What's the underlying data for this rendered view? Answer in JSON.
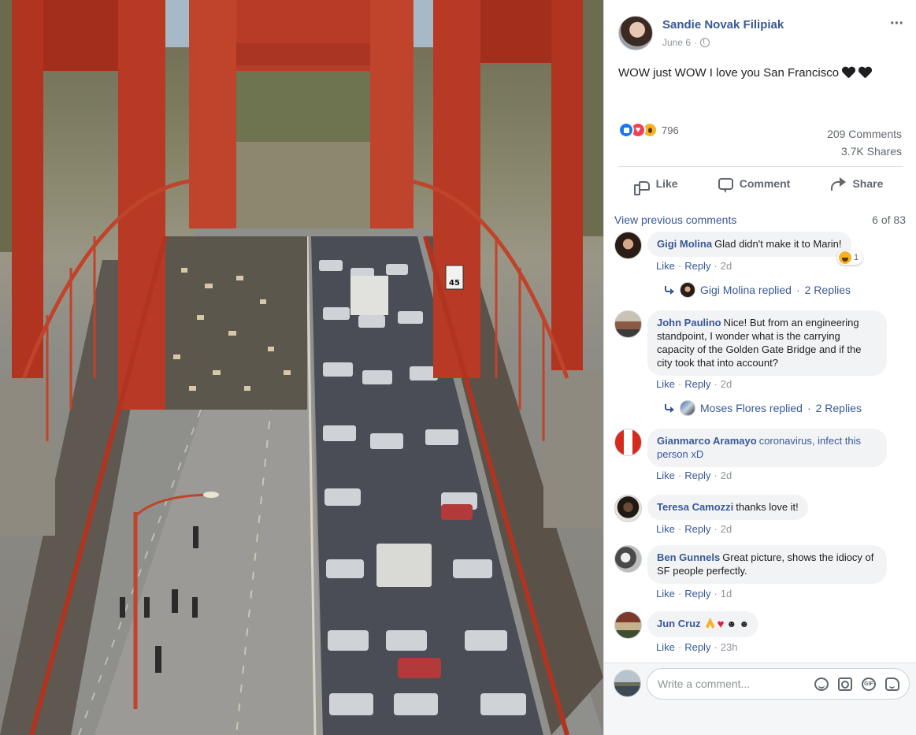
{
  "post": {
    "author": "Sandie Novak Filipiak",
    "date": "June 6",
    "date_separator": "·",
    "text": "WOW just WOW I love you San Francisco",
    "reactions_count": "796",
    "comments_count": "209 Comments",
    "shares_count": "3.7K Shares",
    "photo_icon": "photo",
    "photo_sign": "45"
  },
  "actions": {
    "like": "Like",
    "comment": "Comment",
    "share": "Share"
  },
  "comments_section": {
    "view_previous": "View previous comments",
    "page_count": "6 of 83",
    "like_label": "Like",
    "reply_label": "Reply",
    "separator": "·",
    "items": [
      {
        "name": "Gigi Molina",
        "text": "Glad didn't make it to Marin!",
        "time": "2d",
        "laugh_count": "1",
        "replied_name": "Gigi Molina replied",
        "replied_count": "2 Replies"
      },
      {
        "name": "John Paulino",
        "text": "Nice! But from an engineering standpoint, I wonder what is the carrying capacity of the Golden Gate Bridge and if the city took that into account?",
        "time": "2d",
        "replied_name": "Moses Flores replied",
        "replied_count": "2 Replies"
      },
      {
        "name": "Gianmarco Aramayo",
        "text": "coronavirus, infect this person xD",
        "time": "2d"
      },
      {
        "name": "Teresa Camozzi",
        "text": "thanks love it!",
        "time": "2d"
      },
      {
        "name": "Ben Gunnels",
        "text": "Great picture, shows the idiocy of SF people perfectly.",
        "time": "1d"
      },
      {
        "name": "Jun Cruz",
        "text": "",
        "time": "23h",
        "emoji_dots": "☻ ☻"
      }
    ],
    "composer_placeholder": "Write a comment..."
  },
  "icons": {
    "more": "more-icon",
    "globe": "globe-icon",
    "like": "thumb-icon",
    "comment": "comment-icon",
    "share": "share-icon",
    "emoji": "smile-icon",
    "camera": "camera-icon",
    "gif": "gif-icon",
    "sticker": "sticker-icon",
    "gif_label": "GIF"
  },
  "colors": {
    "link": "#385898",
    "like_reaction": "#1877f2",
    "love_reaction": "#f33e58",
    "wow_reaction": "#f7b125",
    "bridge_red": "#c0392b"
  }
}
